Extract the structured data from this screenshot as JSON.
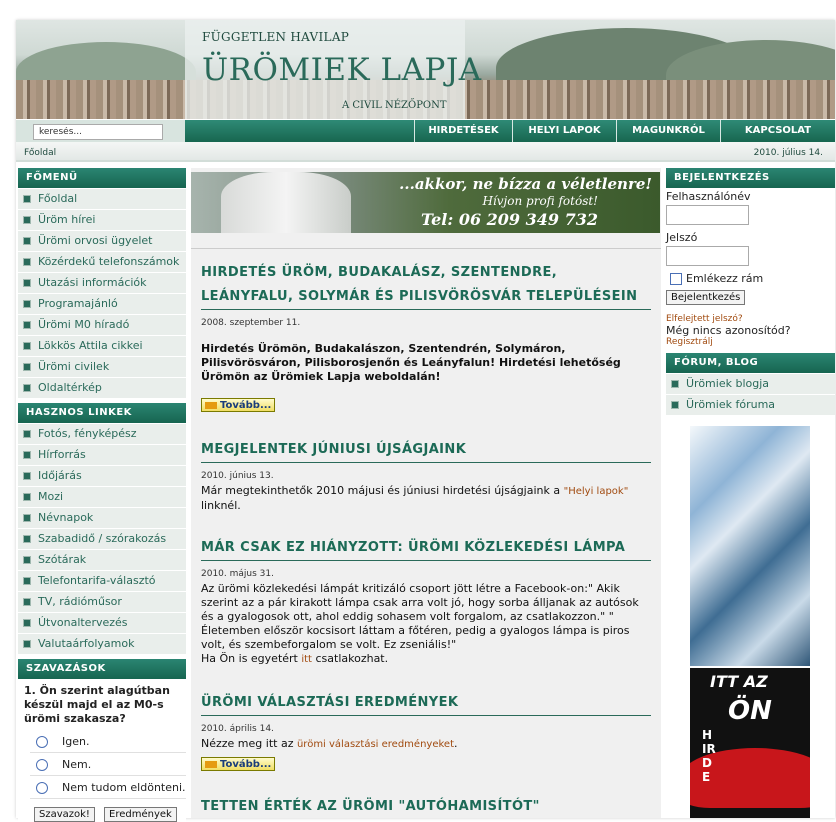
{
  "header": {
    "subtitle": "FÜGGETLEN HAVILAP",
    "title": "ÜRÖMIEK LAPJA",
    "tagline": "A CIVIL NÉZŐPONT"
  },
  "search": {
    "value": "keresés..."
  },
  "nav": [
    "HIRDETÉSEK",
    "HELYI LAPOK",
    "MAGUNKRÓL",
    "KAPCSOLAT"
  ],
  "breadcrumb": "Főoldal",
  "date": "2010. július 14.",
  "left": {
    "main_menu_title": "FŐMENÜ",
    "main_menu": [
      "Főoldal",
      "Üröm hírei",
      "Ürömi orvosi ügyelet",
      "Közérdekű telefonszámok",
      "Utazási információk",
      "Programajánló",
      "Ürömi M0 híradó",
      "Lökkös Attila cikkei",
      "Ürömi civilek",
      "Oldaltérkép"
    ],
    "links_title": "HASZNOS LINKEK",
    "links": [
      "Fotós, fényképész",
      "Hírforrás",
      "Időjárás",
      "Mozi",
      "Névnapok",
      "Szabadidő / szórakozás",
      "Szótárak",
      "Telefontarifa-választó",
      "TV, rádióműsor",
      "Útvonaltervezés",
      "Valutaárfolyamok"
    ],
    "poll_title": "SZAVAZÁSOK",
    "poll_question": "1. Ön szerint alagútban készül majd el az M0-s ürömi szakasza?",
    "poll_options": [
      "Igen.",
      "Nem.",
      "Nem tudom eldönteni."
    ],
    "vote_button": "Szavazok!",
    "results_button": "Eredmények"
  },
  "banner": {
    "line1": "...akkor, ne bízza a véletlenre!",
    "line2": "Hívjon profi fotóst!",
    "line3": "Tel: 06 209 349 732"
  },
  "articles": [
    {
      "title": "HIRDETÉS ÜRÖM, BUDAKALÁSZ, SZENTENDRE, LEÁNYFALU, SOLYMÁR ÉS PILISVÖRÖSVÁR TELEPÜLÉSEIN",
      "date": "2008. szeptember 11.",
      "body": "Hirdetés Ürömön, Budakalászon, Szentendrén, Solymáron, Pilisvörösváron, Pilisborosjenőn és Leányfalun! Hirdetési lehetőség Ürömön az Ürömiek Lapja weboldalán!",
      "more": "Tovább..."
    },
    {
      "title": "MEGJELENTEK JÚNIUSI ÚJSÁGJAINK",
      "date": "2010. június 13.",
      "body_pre": "Már megtekinthetők 2010 májusi és júniusi hirdetési újságjaink a ",
      "link": "\"Helyi lapok\"",
      "body_post": " linknél."
    },
    {
      "title": "MÁR CSAK EZ HIÁNYZOTT: ÜRÖMI KÖZLEKEDÉSI LÁMPA",
      "date": "2010. május 31.",
      "body": "Az ürömi közlekedési lámpát kritizáló csoport jött létre a Facebook-on:\" Akik szerint az a pár kirakott lámpa csak arra volt jó, hogy sorba álljanak az autósok és a gyalogosok ott, ahol eddig sohasem volt forgalom, az csatlakozzon.\" \" Életemben először kocsisort láttam a főtéren, pedig a gyalogos lámpa is piros volt, és szembeforgalom se volt. Ez zseniális!\"",
      "body2_pre": "Ha Ön is egyetért ",
      "link": "itt",
      "body2_post": " csatlakozhat."
    },
    {
      "title": "ÜRÖMI VÁLASZTÁSI EREDMÉNYEK",
      "date": "2010. április 14.",
      "body_pre": "Nézze meg itt az ",
      "link": "ürömi választási eredményeket",
      "body_post": ".",
      "more": "Tovább..."
    },
    {
      "title": "TETTEN ÉRTÉK AZ ÜRÖMI \"AUTÓHAMISÍTÓT\""
    }
  ],
  "right": {
    "login_title": "BEJELENTKEZÉS",
    "username_label": "Felhasználónév",
    "password_label": "Jelszó",
    "remember_label": "Emlékezz rám",
    "login_button": "Bejelentkezés",
    "forgot": "Elfelejtett jelszó?",
    "no_account": "Még nincs azonosítód?",
    "register": "Regisztrálj",
    "forum_title": "FÓRUM, BLOG",
    "forum_items": [
      "Ürömiek blogja",
      "Ürömiek fóruma"
    ],
    "ad_text1": "ITT AZ",
    "ad_text2": "ÖN",
    "ad_text3": "HIRDE"
  }
}
